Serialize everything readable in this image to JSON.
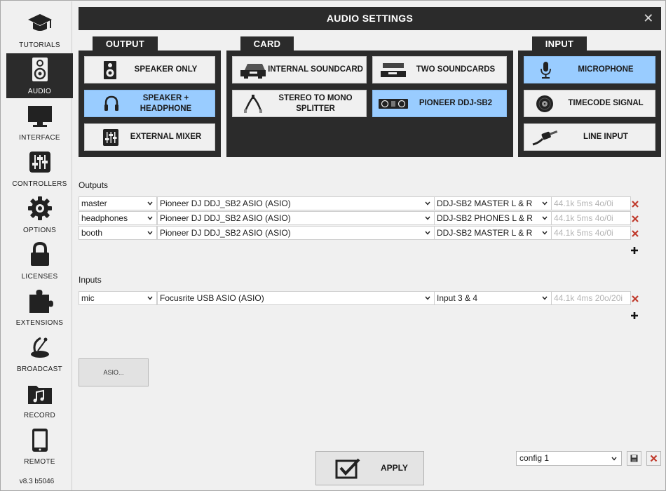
{
  "sidebar": {
    "items": [
      {
        "label": "TUTORIALS",
        "icon": "graduation-cap-icon"
      },
      {
        "label": "AUDIO",
        "icon": "speaker-icon",
        "active": true
      },
      {
        "label": "INTERFACE",
        "icon": "monitor-icon"
      },
      {
        "label": "CONTROLLERS",
        "icon": "sliders-icon"
      },
      {
        "label": "OPTIONS",
        "icon": "gear-icon"
      },
      {
        "label": "LICENSES",
        "icon": "lock-icon"
      },
      {
        "label": "EXTENSIONS",
        "icon": "puzzle-icon"
      },
      {
        "label": "BROADCAST",
        "icon": "satellite-dish-icon"
      },
      {
        "label": "RECORD",
        "icon": "music-folder-icon"
      },
      {
        "label": "REMOTE",
        "icon": "tablet-icon"
      }
    ],
    "version": "v8.3 b5046"
  },
  "title": "AUDIO SETTINGS",
  "output": {
    "label": "OUTPUT",
    "options": [
      {
        "label": "SPEAKER ONLY",
        "icon": "speaker-icon",
        "selected": false
      },
      {
        "label": "SPEAKER + HEADPHONE",
        "icon": "headphones-icon",
        "selected": true
      },
      {
        "label": "EXTERNAL MIXER",
        "icon": "mixer-icon",
        "selected": false
      }
    ]
  },
  "card": {
    "label": "CARD",
    "options": [
      {
        "label": "INTERNAL SOUNDCARD",
        "icon": "soundcard-icon",
        "selected": false
      },
      {
        "label": "TWO SOUNDCARDS",
        "icon": "two-soundcards-icon",
        "selected": false
      },
      {
        "label": "STEREO TO MONO SPLITTER",
        "icon": "splitter-cable-icon",
        "selected": false
      },
      {
        "label": "PIONEER DDJ-SB2",
        "icon": "controller-icon",
        "selected": true
      }
    ]
  },
  "input": {
    "label": "INPUT",
    "options": [
      {
        "label": "MICROPHONE",
        "icon": "microphone-icon",
        "selected": true
      },
      {
        "label": "TIMECODE SIGNAL",
        "icon": "vinyl-icon",
        "selected": false
      },
      {
        "label": "LINE INPUT",
        "icon": "cable-icon",
        "selected": false
      }
    ]
  },
  "outputs": {
    "label": "Outputs",
    "rows": [
      {
        "name": "master",
        "device": "Pioneer DJ DDJ_SB2 ASIO (ASIO)",
        "channel": "DDJ-SB2 MASTER L & R",
        "info": "44.1k 5ms 4o/0i"
      },
      {
        "name": "headphones",
        "device": "Pioneer DJ DDJ_SB2 ASIO (ASIO)",
        "channel": "DDJ-SB2 PHONES L & R",
        "info": "44.1k 5ms 4o/0i"
      },
      {
        "name": "booth",
        "device": "Pioneer DJ DDJ_SB2 ASIO (ASIO)",
        "channel": "DDJ-SB2 MASTER L & R",
        "info": "44.1k 5ms 4o/0i"
      }
    ]
  },
  "inputs": {
    "label": "Inputs",
    "rows": [
      {
        "name": "mic",
        "device": "Focusrite USB ASIO (ASIO)",
        "channel": "Input 3 & 4",
        "info": "44.1k 4ms 20o/20i"
      }
    ]
  },
  "asio_button": "ASIO...",
  "apply_label": "APPLY",
  "config": {
    "value": "config 1"
  },
  "colors": {
    "dark": "#2b2b2b",
    "selected": "#99ccff",
    "background": "#f0f0f0",
    "delete": "#c0392b"
  }
}
